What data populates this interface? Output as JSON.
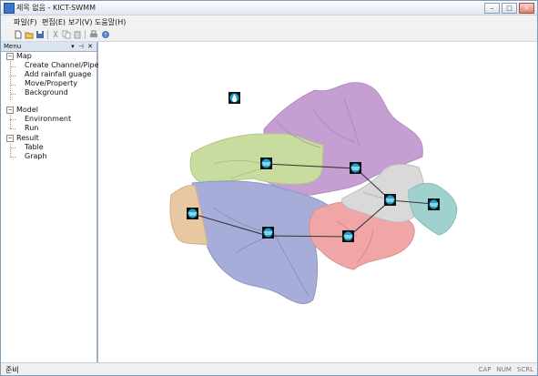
{
  "window": {
    "title": "제목 없음 - KICT-SWMM",
    "buttons": [
      "minimize",
      "maximize",
      "close"
    ]
  },
  "menu": [
    {
      "id": "file",
      "label": "파일(F)"
    },
    {
      "id": "edit",
      "label": "편집(E)"
    },
    {
      "id": "view",
      "label": "보기(V)"
    },
    {
      "id": "help",
      "label": "도움말(H)"
    }
  ],
  "toolbar": [
    "new-icon",
    "open-icon",
    "save-icon",
    "cut-icon",
    "copy-icon",
    "paste-icon",
    "print-icon",
    "about-icon"
  ],
  "sidebar": {
    "title": "Menu",
    "controls": "▾ ⊣ ✕",
    "groups": [
      {
        "label": "Map",
        "items": [
          "Create Channel/Pipes",
          "Add rainfall guage",
          "Move/Property",
          "Background"
        ]
      },
      {
        "label": "Model",
        "items": [
          "Environment",
          "Run"
        ]
      },
      {
        "label": "Result",
        "items": [
          "Table",
          "Graph"
        ]
      }
    ]
  },
  "map": {
    "colors": {
      "purple": "#c69fd2",
      "green": "#c9dc9f",
      "blue": "#a7add9",
      "tan": "#e8c8a2",
      "pink": "#f0a6a6",
      "gray": "#d9d9d9",
      "teal": "#9fd1cf",
      "node": "#1ba3cf"
    },
    "node_icon": "subcatchment-icon",
    "rain_icon": "rain-gauge-icon"
  },
  "status": {
    "left": "준비",
    "indicators": [
      "CAP",
      "NUM",
      "SCRL"
    ]
  }
}
